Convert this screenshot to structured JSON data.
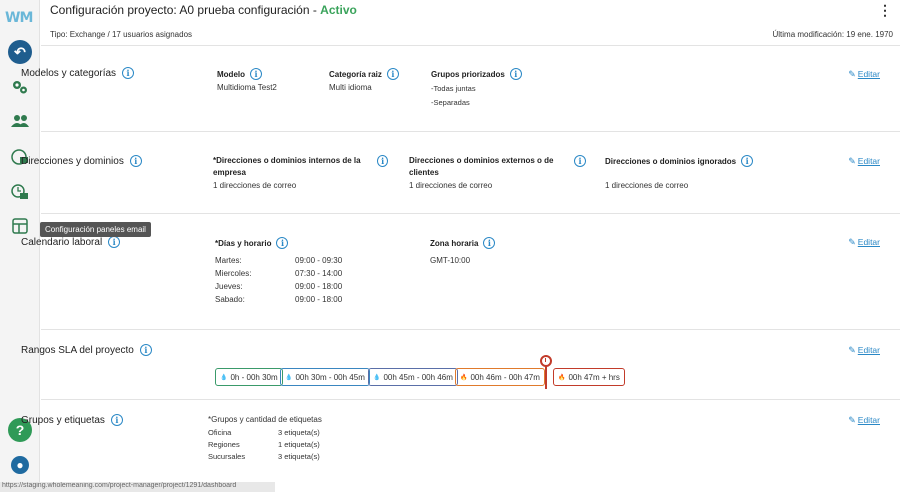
{
  "sidebar": {
    "logo": "WM",
    "tooltip": "Configuración paneles email",
    "icons": [
      "back-icon",
      "settings-gears-icon",
      "users-icon",
      "email-config-icon",
      "email-time-icon",
      "email-panel-icon",
      "help-icon",
      "user-avatar-icon"
    ]
  },
  "header": {
    "title": "Configuración proyecto: A0 prueba configuración - ",
    "status": "Activo",
    "menu": "⋮"
  },
  "subheader": {
    "left": "Tipo: Exchange / 17 usuarios asignados",
    "right": "Última modificación: 19 ene. 1970"
  },
  "edit_label": "Editar",
  "models": {
    "title": "Modelos y categorías",
    "model_label": "Modelo",
    "model_value": "Multidioma Test2",
    "category_label": "Categoría raiz",
    "category_value": "Multi idioma",
    "groups_label": "Grupos priorizados",
    "groups": [
      "-Todas juntas",
      "-Separadas"
    ]
  },
  "domains": {
    "title": "Direcciones y dominios",
    "internal_label": "*Direcciones o dominios internos de la empresa",
    "internal_value": "1 direcciones de correo",
    "external_label": "Direcciones o dominios externos o de clientes",
    "external_value": "1 direcciones de correo",
    "ignored_label": "Direcciones o dominios ignorados",
    "ignored_value": "1 direcciones de correo"
  },
  "calendar": {
    "title": "Calendario laboral",
    "days_label": "*Días y horario",
    "schedule": [
      {
        "day": "Martes:",
        "hours": "09:00 - 09:30"
      },
      {
        "day": "Miercoles:",
        "hours": "07:30 - 14:00"
      },
      {
        "day": "Jueves:",
        "hours": "09:00 - 18:00"
      },
      {
        "day": "Sabado:",
        "hours": "09:00 - 18:00"
      }
    ],
    "tz_label": "Zona horaria",
    "tz_value": "GMT-10:00"
  },
  "sla": {
    "title": "Rangos SLA del proyecto",
    "ranges": [
      {
        "label": "0h - 00h 30m",
        "color": "#3a9a6a",
        "icon": "💧"
      },
      {
        "label": "00h 30m - 00h 45m",
        "color": "#3a86c0",
        "icon": "💧"
      },
      {
        "label": "00h 45m - 00h 46m",
        "color": "#5a6fa8",
        "icon": "💧"
      },
      {
        "label": "00h 46m - 00h 47m",
        "color": "#e07a2c",
        "icon": "🔥"
      },
      {
        "label": "00h 47m + hrs",
        "color": "#c23b2a",
        "icon": "🔥"
      }
    ]
  },
  "groups": {
    "title": "Grupos y etiquetas",
    "header": "*Grupos y cantidad de etiquetas",
    "rows": [
      {
        "name": "Oficina",
        "count": "3 etiqueta(s)"
      },
      {
        "name": "Regiones",
        "count": "1 etiqueta(s)"
      },
      {
        "name": "Sucursales",
        "count": "3 etiqueta(s)"
      }
    ]
  },
  "statusbar": "https://staging.wholemeaning.com/project-manager/project/1291/dashboard"
}
